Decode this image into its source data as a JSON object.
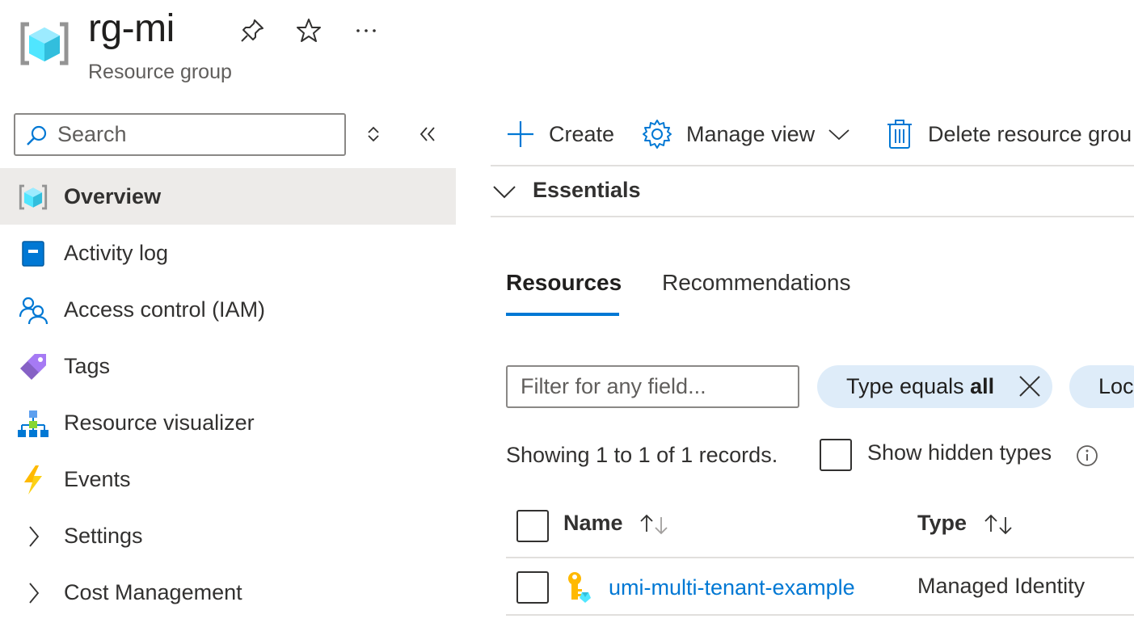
{
  "header": {
    "title": "rg-mi",
    "subtitle": "Resource group",
    "icons": [
      "resource-group-icon",
      "pin-icon",
      "star-icon",
      "more-icon"
    ]
  },
  "sidebar": {
    "search_placeholder": "Search",
    "items": [
      {
        "label": "Overview",
        "icon": "resource-group-icon",
        "active": true
      },
      {
        "label": "Activity log",
        "icon": "activity-log-icon"
      },
      {
        "label": "Access control (IAM)",
        "icon": "people-icon"
      },
      {
        "label": "Tags",
        "icon": "tag-icon"
      },
      {
        "label": "Resource visualizer",
        "icon": "hierarchy-icon"
      },
      {
        "label": "Events",
        "icon": "lightning-icon"
      },
      {
        "label": "Settings",
        "icon": "chevron-right-icon"
      },
      {
        "label": "Cost Management",
        "icon": "chevron-right-icon"
      }
    ]
  },
  "commandbar": {
    "create": "Create",
    "manage_view": "Manage view",
    "delete": "Delete resource grou"
  },
  "essentials": {
    "label": "Essentials"
  },
  "tabs": [
    {
      "label": "Resources",
      "active": true
    },
    {
      "label": "Recommendations"
    }
  ],
  "filters": {
    "placeholder": "Filter for any field...",
    "type_pill_prefix": "Type equals ",
    "type_pill_value": "all",
    "location_pill_prefix": "Loc"
  },
  "records_text": "Showing 1 to 1 of 1 records.",
  "show_hidden_label": "Show hidden types",
  "table": {
    "columns": [
      "Name",
      "Type"
    ],
    "rows": [
      {
        "name": "umi-multi-tenant-example",
        "type": "Managed Identity",
        "icon": "managed-identity-icon"
      }
    ]
  },
  "colors": {
    "accent": "#0078d4",
    "active_bg": "#edebe9",
    "pill_bg": "#deecf9"
  }
}
